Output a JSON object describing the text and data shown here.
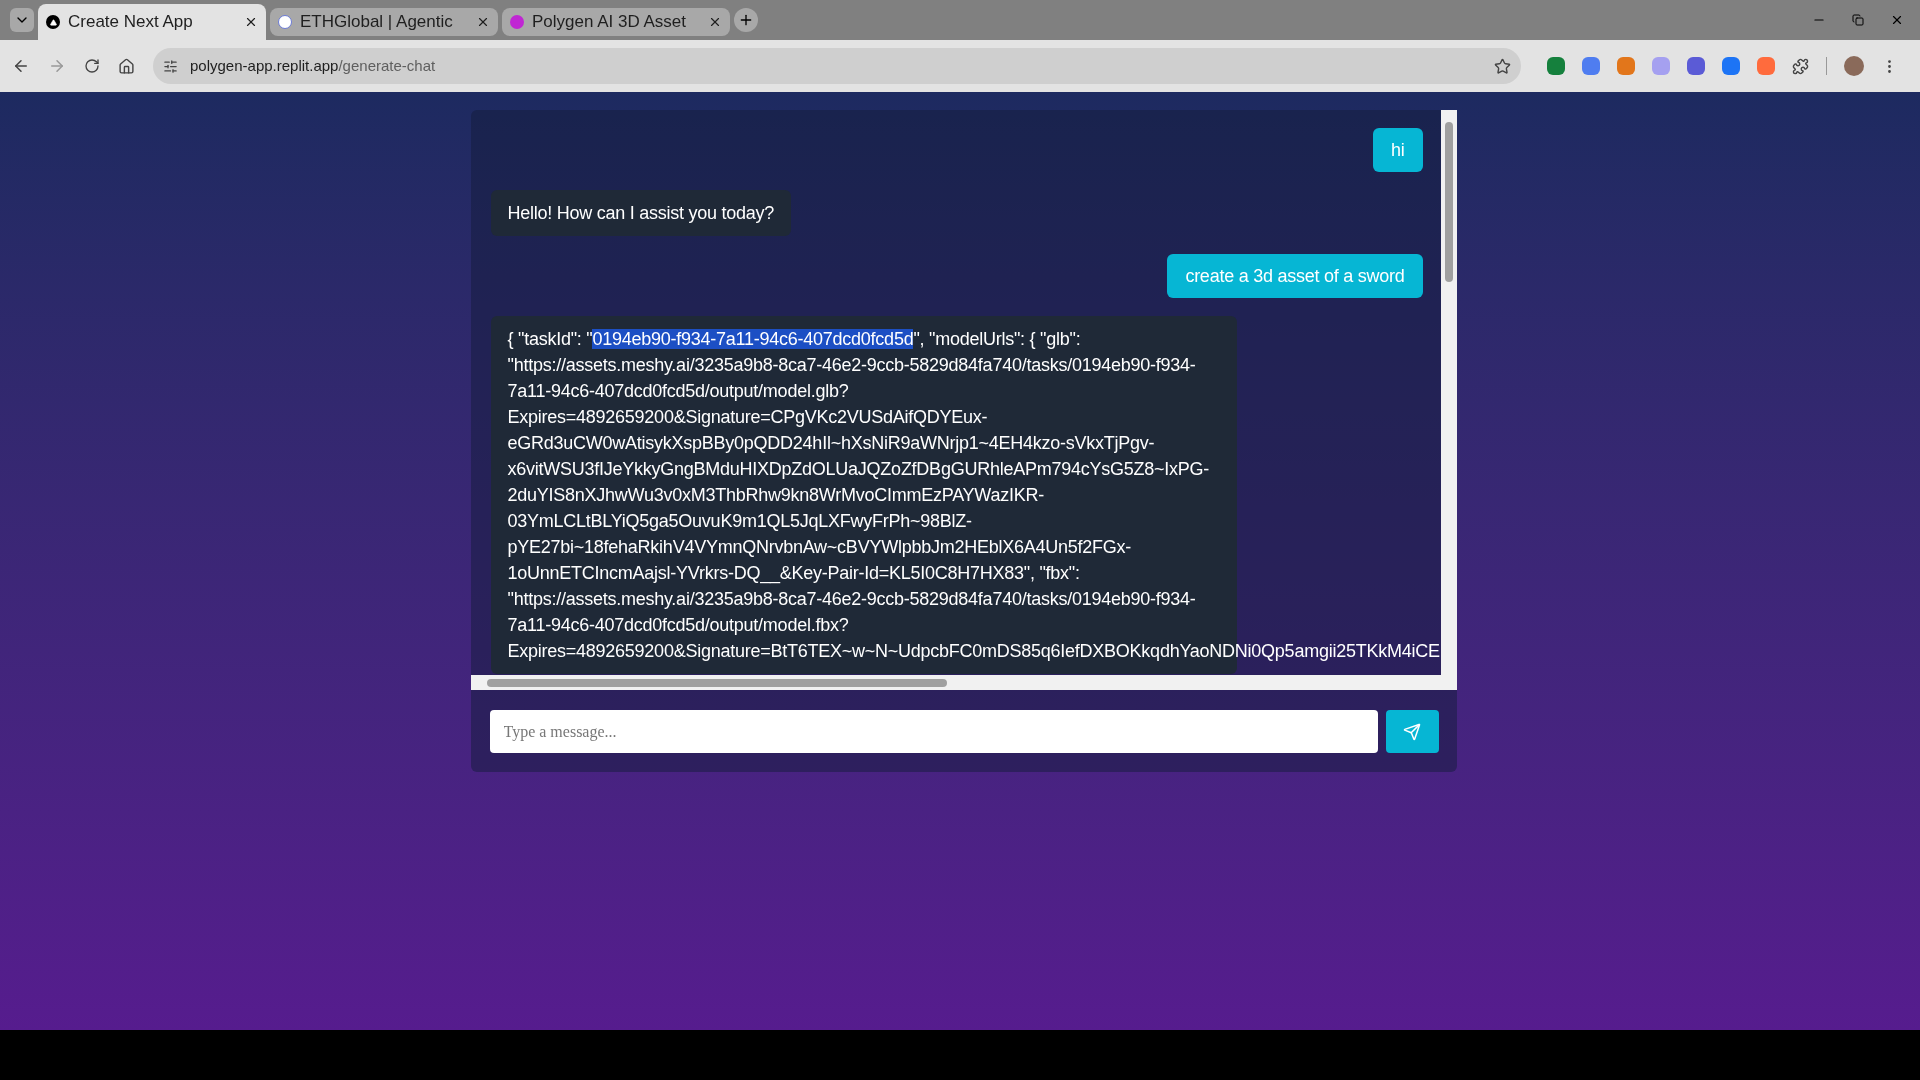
{
  "browser": {
    "tabs": [
      {
        "title": "Create Next App",
        "selected": true
      },
      {
        "title": "ETHGlobal | Agentic",
        "selected": false
      },
      {
        "title": "Polygen AI 3D Asset",
        "selected": false
      }
    ],
    "address": {
      "host": "polygen-app.replit.app",
      "path": "/generate-chat"
    }
  },
  "chat": {
    "messages": [
      {
        "kind": "user",
        "lines": [
          [
            {
              "text": "hi",
              "selected": false
            }
          ]
        ]
      },
      {
        "kind": "assistant",
        "lines": [
          [
            {
              "text": "Hello! How can I assist you today?",
              "selected": false
            }
          ]
        ]
      },
      {
        "kind": "user",
        "lines": [
          [
            {
              "text": "create a 3d asset of a sword",
              "selected": false
            }
          ]
        ]
      },
      {
        "kind": "assistant",
        "lines": [
          [
            {
              "text": "{ \"taskId\": \"",
              "selected": false
            },
            {
              "text": "0194eb90-f934-7a11-94c6-407dcd0fcd5d",
              "selected": true
            },
            {
              "text": "\", \"modelUrls\": { \"glb\":",
              "selected": false
            }
          ],
          [
            {
              "text": "\"https://assets.meshy.ai/3235a9b8-8ca7-46e2-9ccb-5829d84fa740/tasks/0194eb90-f934-",
              "selected": false
            }
          ],
          [
            {
              "text": "7a11-94c6-407dcd0fcd5d/output/model.glb?",
              "selected": false
            }
          ],
          [
            {
              "text": "Expires=4892659200&Signature=CPgVKc2VUSdAifQDYEux-",
              "selected": false
            }
          ],
          [
            {
              "text": "eGRd3uCW0wAtisykXspBBy0pQDD24hIl~hXsNiR9aWNrjp1~4EH4kzo-sVkxTjPgv-",
              "selected": false
            }
          ],
          [
            {
              "text": "x6vitWSU3fIJeYkkyGngBMduHIXDpZdOLUaJQZoZfDBgGURhleAPm794cYsG5Z8~IxPG-",
              "selected": false
            }
          ],
          [
            {
              "text": "2duYIS8nXJhwWu3v0xM3ThbRhw9kn8WrMvoCImmEzPAYWazIKR-",
              "selected": false
            }
          ],
          [
            {
              "text": "03YmLCLtBLYiQ5ga5OuvuK9m1QL5JqLXFwyFrPh~98BlZ-",
              "selected": false
            }
          ],
          [
            {
              "text": "pYE27bi~18fehaRkihV4VYmnQNrvbnAw~cBVYWlpbbJm2HEblX6A4Un5f2FGx-",
              "selected": false
            }
          ],
          [
            {
              "text": "1oUnnETCIncmAajsl-YVrkrs-DQ__&Key-Pair-Id=KL5I0C8H7HX83\", \"fbx\":",
              "selected": false
            }
          ],
          [
            {
              "text": "\"https://assets.meshy.ai/3235a9b8-8ca7-46e2-9ccb-5829d84fa740/tasks/0194eb90-f934-",
              "selected": false
            }
          ],
          [
            {
              "text": "7a11-94c6-407dcd0fcd5d/output/model.fbx?",
              "selected": false
            }
          ],
          [
            {
              "text": "Expires=4892659200&Signature=BtT6TEX~w~N~UdpcbFC0mDS85q6IefDXBOKkqdhYaoNDNi0Qp5amgii25TKkM4iCE",
              "selected": false
            }
          ]
        ]
      }
    ],
    "input": {
      "placeholder": "Type a message..."
    }
  }
}
